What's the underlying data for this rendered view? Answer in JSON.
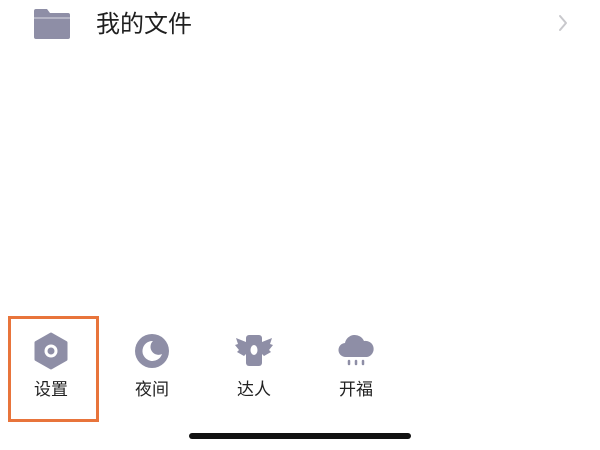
{
  "files_row": {
    "label": "我的文件",
    "icon": "folder-icon",
    "chevron": "chevron-right-icon"
  },
  "shortcuts": [
    {
      "label": "设置",
      "icon": "settings-hexagon-icon",
      "highlighted": true
    },
    {
      "label": "夜间",
      "icon": "moon-icon",
      "highlighted": false
    },
    {
      "label": "达人",
      "icon": "winged-badge-icon",
      "highlighted": false
    },
    {
      "label": "开福",
      "icon": "cloud-rain-icon",
      "highlighted": false
    }
  ],
  "colors": {
    "icon_gray": "#8e8ea6",
    "highlight": "#e8743b",
    "text": "#222222",
    "chevron": "#c8c8cc",
    "home_indicator": "#111111",
    "background": "#ffffff"
  }
}
